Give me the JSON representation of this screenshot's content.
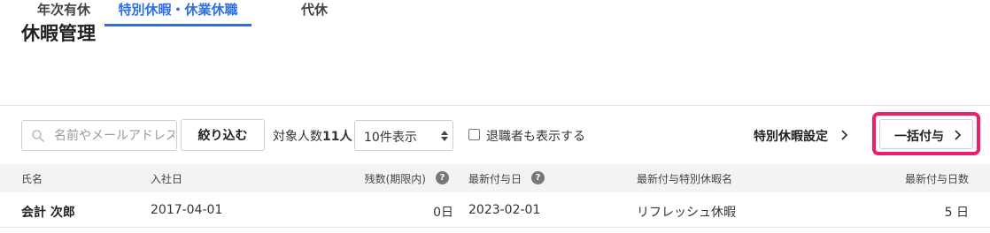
{
  "page": {
    "title": "休暇管理"
  },
  "tabs": [
    {
      "label": "年次有休",
      "active": false
    },
    {
      "label": "特別休暇・休業休職",
      "active": true
    },
    {
      "label": "代休",
      "active": false
    }
  ],
  "toolbar": {
    "search_placeholder": "名前やメールアドレス",
    "filter_label": "絞り込む",
    "count_label": "対象人数",
    "count_value": "11人",
    "page_size_selected": "10件表示",
    "show_retired_label": "退職者も表示する",
    "show_retired_checked": false,
    "special_leave_settings_label": "特別休暇設定",
    "bulk_grant_label": "一括付与",
    "highlight_color": "#ea1f6d",
    "accent_color": "#2f6fe0"
  },
  "table": {
    "columns": [
      "氏名",
      "入社日",
      "残数(期限内)",
      "最新付与日",
      "最新付与特別休暇名",
      "最新付与日数"
    ],
    "help_icon_glyph": "?",
    "rows": [
      {
        "name": "会計 次郎",
        "joined": "2017-04-01",
        "remaining": "0日",
        "last_grant_date": "2023-02-01",
        "last_grant_leave_name": "リフレッシュ休暇",
        "last_grant_days": "5 日"
      }
    ]
  }
}
